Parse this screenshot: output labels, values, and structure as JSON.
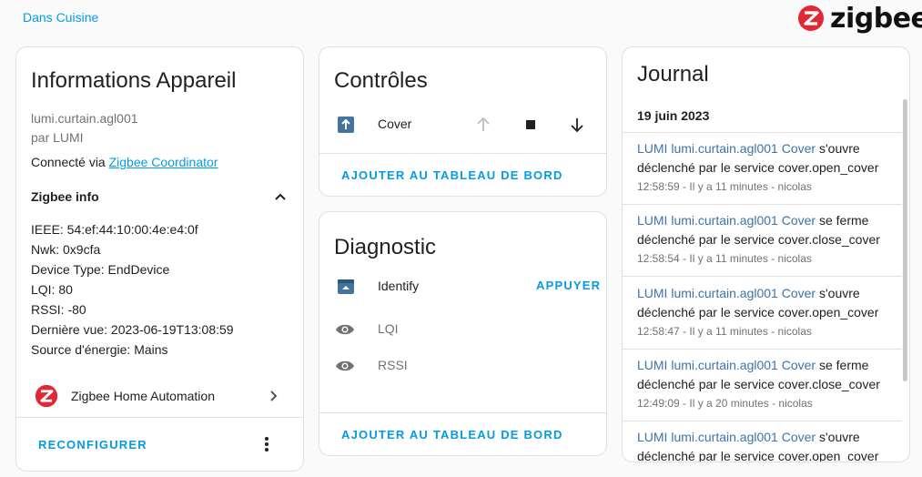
{
  "header": {
    "area_link": "Dans Cuisine",
    "logo_text": "zigbee"
  },
  "colors": {
    "accent": "#039be5",
    "zigbee_red": "#e02935",
    "logbook_name": "#3f73a8",
    "icon_primary": "#44739e"
  },
  "device_info": {
    "title": "Informations Appareil",
    "model": "lumi.curtain.agl001",
    "manufacturer": "par LUMI",
    "connected_prefix": "Connecté via",
    "connected_link": "Zigbee Coordinator",
    "zigbee_info_title": "Zigbee info",
    "details": [
      "IEEE: 54:ef:44:10:00:4e:e4:0f",
      "Nwk: 0x9cfa",
      "Device Type: EndDevice",
      "LQI: 80",
      "RSSI: -80",
      "Dernière vue: 2023-06-19T13:08:59",
      "Source d'énergie: Mains"
    ],
    "integration_label": "Zigbee Home Automation",
    "reconfigure_label": "RECONFIGURER"
  },
  "controls": {
    "title": "Contrôles",
    "entity_name": "Cover",
    "add_dashboard_label": "AJOUTER AU TABLEAU DE BORD"
  },
  "diagnostic": {
    "title": "Diagnostic",
    "identify_label": "Identify",
    "press_label": "APPUYER",
    "lqi_label": "LQI",
    "rssi_label": "RSSI",
    "add_dashboard_label": "AJOUTER AU TABLEAU DE BORD"
  },
  "logbook": {
    "title": "Journal",
    "date": "19 juin 2023",
    "entries": [
      {
        "name": "LUMI lumi.curtain.agl001 Cover",
        "action": " s'ouvre",
        "context": "déclenché par le service cover.open_cover",
        "meta": "12:58:59 - Il y a 11 minutes - nicolas"
      },
      {
        "name": "LUMI lumi.curtain.agl001 Cover",
        "action": " se ferme",
        "context": "déclenché par le service cover.close_cover",
        "meta": "12:58:54 - Il y a 11 minutes - nicolas"
      },
      {
        "name": "LUMI lumi.curtain.agl001 Cover",
        "action": " s'ouvre",
        "context": "déclenché par le service cover.open_cover",
        "meta": "12:58:47 - Il y a 11 minutes - nicolas"
      },
      {
        "name": "LUMI lumi.curtain.agl001 Cover",
        "action": " se ferme",
        "context": "déclenché par le service cover.close_cover",
        "meta": "12:49:09 - Il y a 20 minutes - nicolas"
      },
      {
        "name": "LUMI lumi.curtain.agl001 Cover",
        "action": " s'ouvre",
        "context": "déclenché par le service cover.open_cover",
        "meta": ""
      }
    ]
  }
}
